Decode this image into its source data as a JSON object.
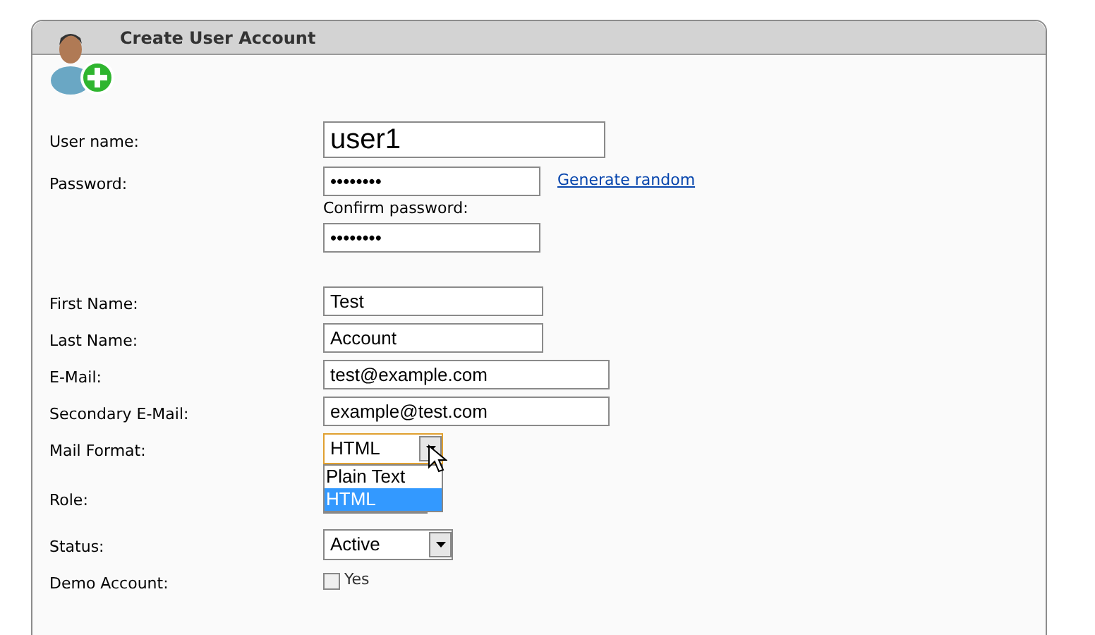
{
  "header": {
    "title": "Create User Account"
  },
  "form": {
    "username": {
      "label": "User name:",
      "value": "user1"
    },
    "password": {
      "label": "Password:",
      "value": "••••••••",
      "link": "Generate random"
    },
    "confirm_password": {
      "label": "Confirm password:",
      "value": "••••••••"
    },
    "first_name": {
      "label": "First Name:",
      "value": "Test"
    },
    "last_name": {
      "label": "Last Name:",
      "value": "Account"
    },
    "email": {
      "label": "E-Mail:",
      "value": "test@example.com"
    },
    "secondary_email": {
      "label": "Secondary E-Mail:",
      "value": "example@test.com"
    },
    "mail_format": {
      "label": "Mail Format:",
      "value": "HTML",
      "expanded": true,
      "options": [
        {
          "label": "Plain Text",
          "selected": false
        },
        {
          "label": "HTML",
          "selected": true
        }
      ]
    },
    "role": {
      "label": "Role:"
    },
    "status": {
      "label": "Status:",
      "value": "Active"
    },
    "demo_account": {
      "label": "Demo Account:",
      "checked": false,
      "option_label": "Yes"
    }
  }
}
